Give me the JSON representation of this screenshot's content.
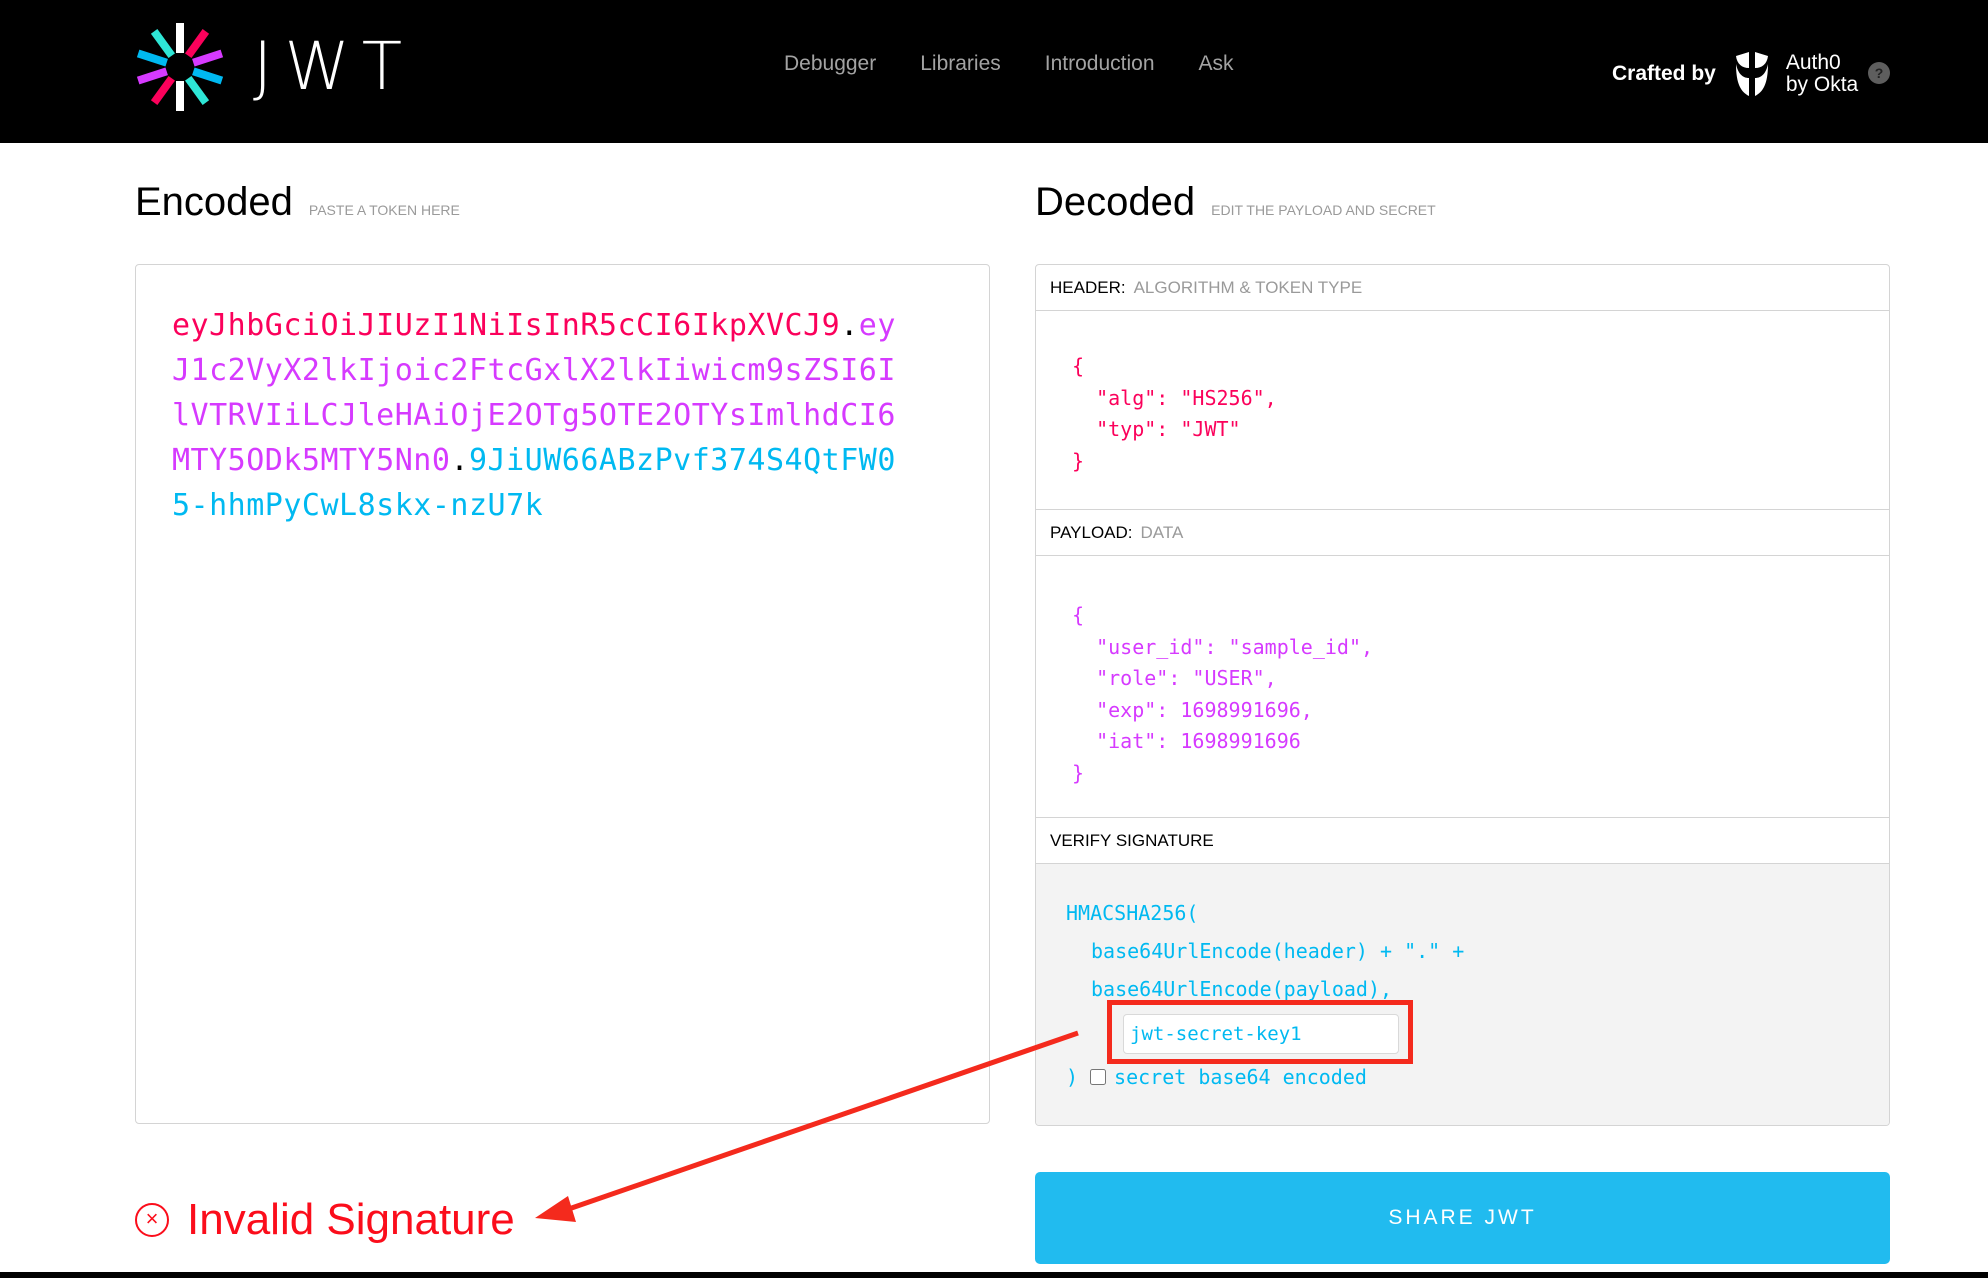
{
  "header": {
    "logo_text": "JWT",
    "nav": [
      "Debugger",
      "Libraries",
      "Introduction",
      "Ask"
    ],
    "crafted_by_label": "Crafted by",
    "brand_line1": "Auth0",
    "brand_line2": "by Okta",
    "help_label": "?"
  },
  "encoded": {
    "title": "Encoded",
    "subtitle": "PASTE A TOKEN HERE",
    "token_header": "eyJhbGciOiJIUzI1NiIsInR5cCI6IkpXVCJ9",
    "token_payload": "eyJ1c2VyX2lkIjoic2FtcGxlX2lkIiwicm9sZSI6IlVTRVIiLCJleHAiOjE2OTg5OTE2OTYsImlhdCI6MTY5ODk5MTY5Nn0",
    "token_signature": "9JiUW66ABzPvf374S4QtFW05-hhmPyCwL8skx-nzU7k",
    "dot": "."
  },
  "decoded": {
    "title": "Decoded",
    "subtitle": "EDIT THE PAYLOAD AND SECRET",
    "header_section": {
      "label": "HEADER:",
      "sublabel": "ALGORITHM & TOKEN TYPE",
      "json": "{\n  \"alg\": \"HS256\",\n  \"typ\": \"JWT\"\n}"
    },
    "payload_section": {
      "label": "PAYLOAD:",
      "sublabel": "DATA",
      "json": "{\n  \"user_id\": \"sample_id\",\n  \"role\": \"USER\",\n  \"exp\": 1698991696,\n  \"iat\": 1698991696\n}"
    },
    "verify_section": {
      "label": "VERIFY SIGNATURE",
      "line1": "HMACSHA256(",
      "line2": "base64UrlEncode(header) + \".\" +",
      "line3": "base64UrlEncode(payload),",
      "secret_value": "jwt-secret-key1",
      "close_paren": ")",
      "base64_label": "secret base64 encoded",
      "base64_checked": false
    }
  },
  "status": {
    "icon": "x-circle-icon",
    "text": "Invalid Signature",
    "color": "#fb0d1b"
  },
  "share_button": "SHARE JWT",
  "colors": {
    "header_red": "#fb015b",
    "payload_purple": "#d63aff",
    "signature_blue": "#00b9f1",
    "share_bg": "#21bbef",
    "annotation_red": "#f42a1d"
  }
}
